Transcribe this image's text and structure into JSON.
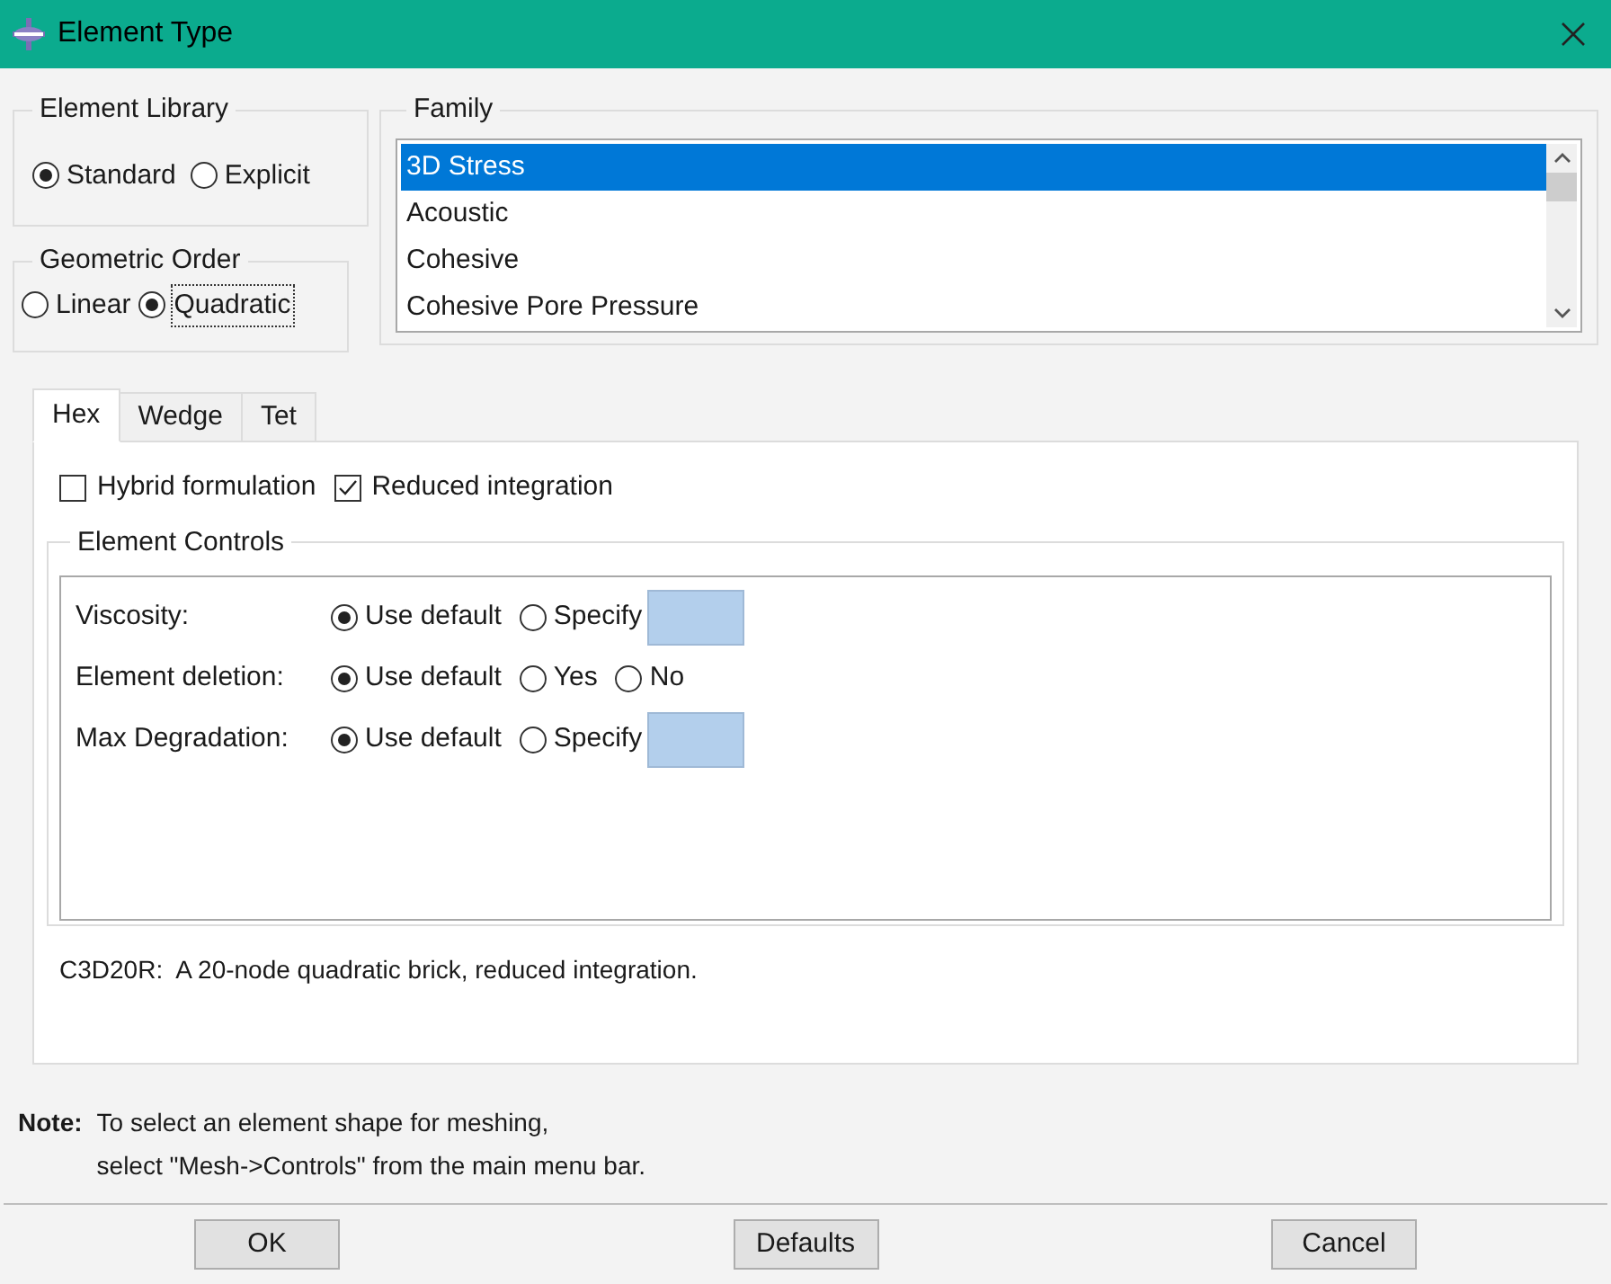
{
  "window": {
    "title": "Element Type"
  },
  "element_library": {
    "label": "Element Library",
    "options": [
      {
        "label": "Standard",
        "selected": true,
        "focused": false
      },
      {
        "label": "Explicit",
        "selected": false,
        "focused": false
      }
    ]
  },
  "geometric_order": {
    "label": "Geometric Order",
    "options": [
      {
        "label": "Linear",
        "selected": false,
        "focused": false
      },
      {
        "label": "Quadratic",
        "selected": true,
        "focused": true
      }
    ]
  },
  "family": {
    "label": "Family",
    "items": [
      {
        "label": "3D Stress",
        "selected": true
      },
      {
        "label": "Acoustic",
        "selected": false
      },
      {
        "label": "Cohesive",
        "selected": false
      },
      {
        "label": "Cohesive Pore Pressure",
        "selected": false
      }
    ]
  },
  "tabs": [
    {
      "label": "Hex",
      "selected": true
    },
    {
      "label": "Wedge",
      "selected": false
    },
    {
      "label": "Tet",
      "selected": false
    }
  ],
  "checkboxes": [
    {
      "label": "Hybrid formulation",
      "checked": false
    },
    {
      "label": "Reduced integration",
      "checked": true
    }
  ],
  "element_controls": {
    "label": "Element Controls",
    "rows": [
      {
        "label": "Viscosity:",
        "has_value_field": true,
        "options": [
          {
            "label": "Use default",
            "selected": true
          },
          {
            "label": "Specify",
            "selected": false
          }
        ]
      },
      {
        "label": "Element deletion:",
        "has_value_field": false,
        "options": [
          {
            "label": "Use default",
            "selected": true
          },
          {
            "label": "Yes",
            "selected": false
          },
          {
            "label": "No",
            "selected": false
          }
        ]
      },
      {
        "label": "Max Degradation:",
        "has_value_field": true,
        "options": [
          {
            "label": "Use default",
            "selected": true
          },
          {
            "label": "Specify",
            "selected": false
          }
        ]
      }
    ]
  },
  "description": "C3D20R:  A 20-node quadratic brick, reduced integration.",
  "note": {
    "label": "Note:",
    "lines": [
      "To select an element shape for meshing,",
      "select \"Mesh->Controls\" from the main menu bar."
    ]
  },
  "buttons": [
    "OK",
    "Defaults",
    "Cancel"
  ]
}
